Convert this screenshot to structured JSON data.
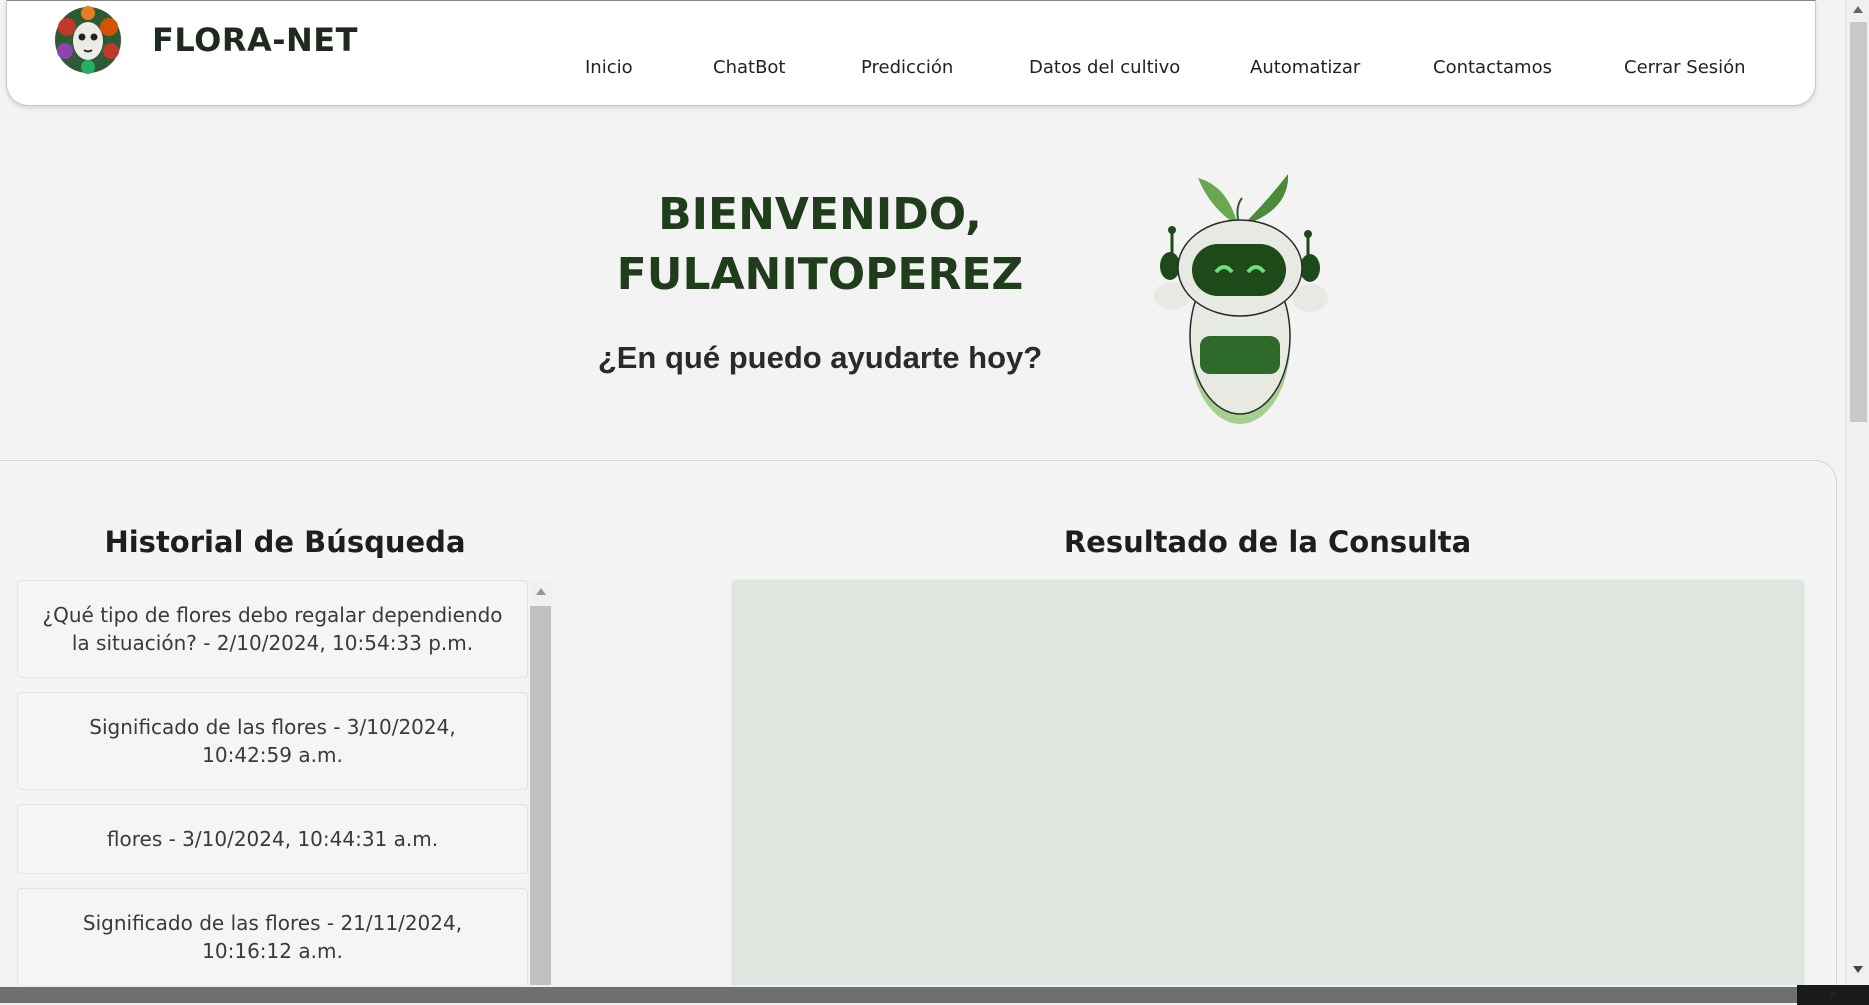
{
  "header": {
    "brand": "FLORA-NET",
    "nav": [
      {
        "label": "Inicio"
      },
      {
        "label": "ChatBot"
      },
      {
        "label": "Predicción"
      },
      {
        "label": "Datos del cultivo"
      },
      {
        "label": "Automatizar"
      },
      {
        "label": "Contactamos"
      },
      {
        "label": "Cerrar Sesión"
      }
    ]
  },
  "hero": {
    "title_line1": "BIENVENIDO,",
    "title_line2": "FULANITOPEREZ",
    "subtitle": "¿En qué puedo ayudarte hoy?",
    "mascot_icon": "robot-plant-mascot-icon"
  },
  "history": {
    "title": "Historial de Búsqueda",
    "items": [
      {
        "text": "¿Qué tipo de flores debo regalar dependiendo la situación? - 2/10/2024, 10:54:33 p.m."
      },
      {
        "text": "Significado de las flores - 3/10/2024, 10:42:59 a.m."
      },
      {
        "text": "flores - 3/10/2024, 10:44:31 a.m."
      },
      {
        "text": "Significado de las flores - 21/11/2024, 10:16:12 a.m."
      }
    ]
  },
  "result": {
    "title": "Resultado de la Consulta",
    "content": ""
  },
  "colors": {
    "brand_dark_green": "#1f3d1a",
    "mascot_green": "#2e6b2a",
    "result_bg": "#dfe5df",
    "page_bg": "#f3f3f3"
  }
}
